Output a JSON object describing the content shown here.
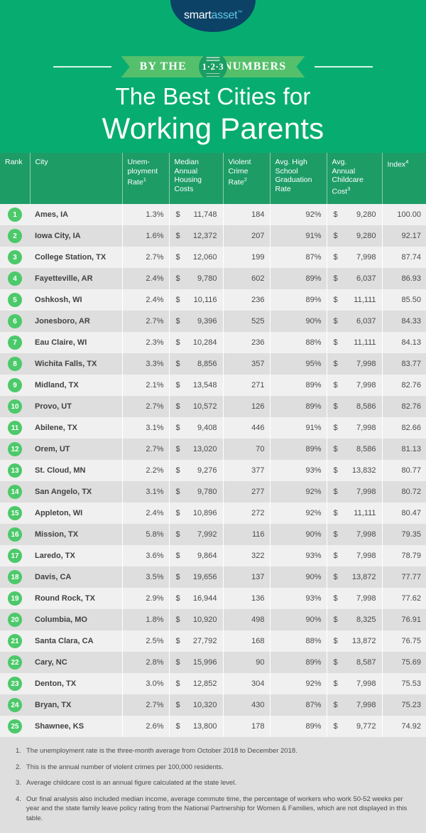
{
  "brand": {
    "logo_smart": "smart",
    "logo_asset": "asset",
    "logo_tm": "™"
  },
  "ribbon": {
    "left_text": "BY THE",
    "badge_text": "1·2·3",
    "right_text": "NUMBERS"
  },
  "title": {
    "line1": "The Best Cities for",
    "line2": "Working Parents"
  },
  "colors": {
    "background_green": "#10a96e",
    "header_green": "#07ad70",
    "table_header_green": "#1d9c66",
    "ribbon_green": "#55c06b",
    "badge_green": "#1a9e63",
    "rank_circle_green": "#4cc96a",
    "logo_navy": "#0b4266",
    "logo_blue": "#63c7e8",
    "row_odd": "#f0f0f0",
    "row_even": "#dedede",
    "text_gray": "#4a4a4a"
  },
  "table": {
    "columns": [
      {
        "label": "Rank",
        "sup": ""
      },
      {
        "label": "City",
        "sup": ""
      },
      {
        "label": "Unem-\nployment\nRate",
        "sup": "1"
      },
      {
        "label": "Median\nAnnual\nHousing\nCosts",
        "sup": ""
      },
      {
        "label": "Violent\nCrime\nRate",
        "sup": "2"
      },
      {
        "label": "Avg. High\nSchool\nGraduation\nRate",
        "sup": ""
      },
      {
        "label": "Avg.\nAnnual\nChildcare\nCost",
        "sup": "3"
      },
      {
        "label": "Index",
        "sup": "4"
      }
    ],
    "currency_symbol": "$",
    "rows": [
      {
        "rank": "1",
        "city": "Ames, IA",
        "unemployment": "1.3%",
        "housing": "11,748",
        "crime": "184",
        "graduation": "92%",
        "childcare": "9,280",
        "index": "100.00"
      },
      {
        "rank": "2",
        "city": "Iowa City, IA",
        "unemployment": "1.6%",
        "housing": "12,372",
        "crime": "207",
        "graduation": "91%",
        "childcare": "9,280",
        "index": "92.17"
      },
      {
        "rank": "3",
        "city": "College Station, TX",
        "unemployment": "2.7%",
        "housing": "12,060",
        "crime": "199",
        "graduation": "87%",
        "childcare": "7,998",
        "index": "87.74"
      },
      {
        "rank": "4",
        "city": "Fayetteville, AR",
        "unemployment": "2.4%",
        "housing": "9,780",
        "crime": "602",
        "graduation": "89%",
        "childcare": "6,037",
        "index": "86.93"
      },
      {
        "rank": "5",
        "city": "Oshkosh, WI",
        "unemployment": "2.4%",
        "housing": "10,116",
        "crime": "236",
        "graduation": "89%",
        "childcare": "11,111",
        "index": "85.50"
      },
      {
        "rank": "6",
        "city": "Jonesboro, AR",
        "unemployment": "2.7%",
        "housing": "9,396",
        "crime": "525",
        "graduation": "90%",
        "childcare": "6,037",
        "index": "84.33"
      },
      {
        "rank": "7",
        "city": "Eau Claire, WI",
        "unemployment": "2.3%",
        "housing": "10,284",
        "crime": "236",
        "graduation": "88%",
        "childcare": "11,111",
        "index": "84.13"
      },
      {
        "rank": "8",
        "city": "Wichita Falls, TX",
        "unemployment": "3.3%",
        "housing": "8,856",
        "crime": "357",
        "graduation": "95%",
        "childcare": "7,998",
        "index": "83.77"
      },
      {
        "rank": "9",
        "city": "Midland, TX",
        "unemployment": "2.1%",
        "housing": "13,548",
        "crime": "271",
        "graduation": "89%",
        "childcare": "7,998",
        "index": "82.76"
      },
      {
        "rank": "10",
        "city": "Provo, UT",
        "unemployment": "2.7%",
        "housing": "10,572",
        "crime": "126",
        "graduation": "89%",
        "childcare": "8,586",
        "index": "82.76"
      },
      {
        "rank": "11",
        "city": "Abilene, TX",
        "unemployment": "3.1%",
        "housing": "9,408",
        "crime": "446",
        "graduation": "91%",
        "childcare": "7,998",
        "index": "82.66"
      },
      {
        "rank": "12",
        "city": "Orem, UT",
        "unemployment": "2.7%",
        "housing": "13,020",
        "crime": "70",
        "graduation": "89%",
        "childcare": "8,586",
        "index": "81.13"
      },
      {
        "rank": "13",
        "city": "St. Cloud, MN",
        "unemployment": "2.2%",
        "housing": "9,276",
        "crime": "377",
        "graduation": "93%",
        "childcare": "13,832",
        "index": "80.77"
      },
      {
        "rank": "14",
        "city": "San Angelo, TX",
        "unemployment": "3.1%",
        "housing": "9,780",
        "crime": "277",
        "graduation": "92%",
        "childcare": "7,998",
        "index": "80.72"
      },
      {
        "rank": "15",
        "city": "Appleton, WI",
        "unemployment": "2.4%",
        "housing": "10,896",
        "crime": "272",
        "graduation": "92%",
        "childcare": "11,111",
        "index": "80.47"
      },
      {
        "rank": "16",
        "city": "Mission, TX",
        "unemployment": "5.8%",
        "housing": "7,992",
        "crime": "116",
        "graduation": "90%",
        "childcare": "7,998",
        "index": "79.35"
      },
      {
        "rank": "17",
        "city": "Laredo, TX",
        "unemployment": "3.6%",
        "housing": "9,864",
        "crime": "322",
        "graduation": "93%",
        "childcare": "7,998",
        "index": "78.79"
      },
      {
        "rank": "18",
        "city": "Davis, CA",
        "unemployment": "3.5%",
        "housing": "19,656",
        "crime": "137",
        "graduation": "90%",
        "childcare": "13,872",
        "index": "77.77"
      },
      {
        "rank": "19",
        "city": "Round Rock, TX",
        "unemployment": "2.9%",
        "housing": "16,944",
        "crime": "136",
        "graduation": "93%",
        "childcare": "7,998",
        "index": "77.62"
      },
      {
        "rank": "20",
        "city": "Columbia, MO",
        "unemployment": "1.8%",
        "housing": "10,920",
        "crime": "498",
        "graduation": "90%",
        "childcare": "8,325",
        "index": "76.91"
      },
      {
        "rank": "21",
        "city": "Santa Clara, CA",
        "unemployment": "2.5%",
        "housing": "27,792",
        "crime": "168",
        "graduation": "88%",
        "childcare": "13,872",
        "index": "76.75"
      },
      {
        "rank": "22",
        "city": "Cary, NC",
        "unemployment": "2.8%",
        "housing": "15,996",
        "crime": "90",
        "graduation": "89%",
        "childcare": "8,587",
        "index": "75.69"
      },
      {
        "rank": "23",
        "city": "Denton, TX",
        "unemployment": "3.0%",
        "housing": "12,852",
        "crime": "304",
        "graduation": "92%",
        "childcare": "7,998",
        "index": "75.53"
      },
      {
        "rank": "24",
        "city": "Bryan, TX",
        "unemployment": "2.7%",
        "housing": "10,320",
        "crime": "430",
        "graduation": "87%",
        "childcare": "7,998",
        "index": "75.23"
      },
      {
        "rank": "25",
        "city": "Shawnee, KS",
        "unemployment": "2.6%",
        "housing": "13,800",
        "crime": "178",
        "graduation": "89%",
        "childcare": "9,772",
        "index": "74.92"
      }
    ]
  },
  "footnotes": [
    {
      "num": "1.",
      "text": "The unemployment rate is the three-month average from October 2018 to December 2018."
    },
    {
      "num": "2.",
      "text": "This is the annual number of violent crimes per 100,000 residents."
    },
    {
      "num": "3.",
      "text": "Average childcare cost is  an annual figure calculated at the state level."
    },
    {
      "num": "4.",
      "text": "Our final analysis also included median income, average commute time, the percentage of workers who work 50-52 weeks per year and the state family leave policy rating from the National Partnership for Women & Families, which are not displayed in this table."
    }
  ]
}
